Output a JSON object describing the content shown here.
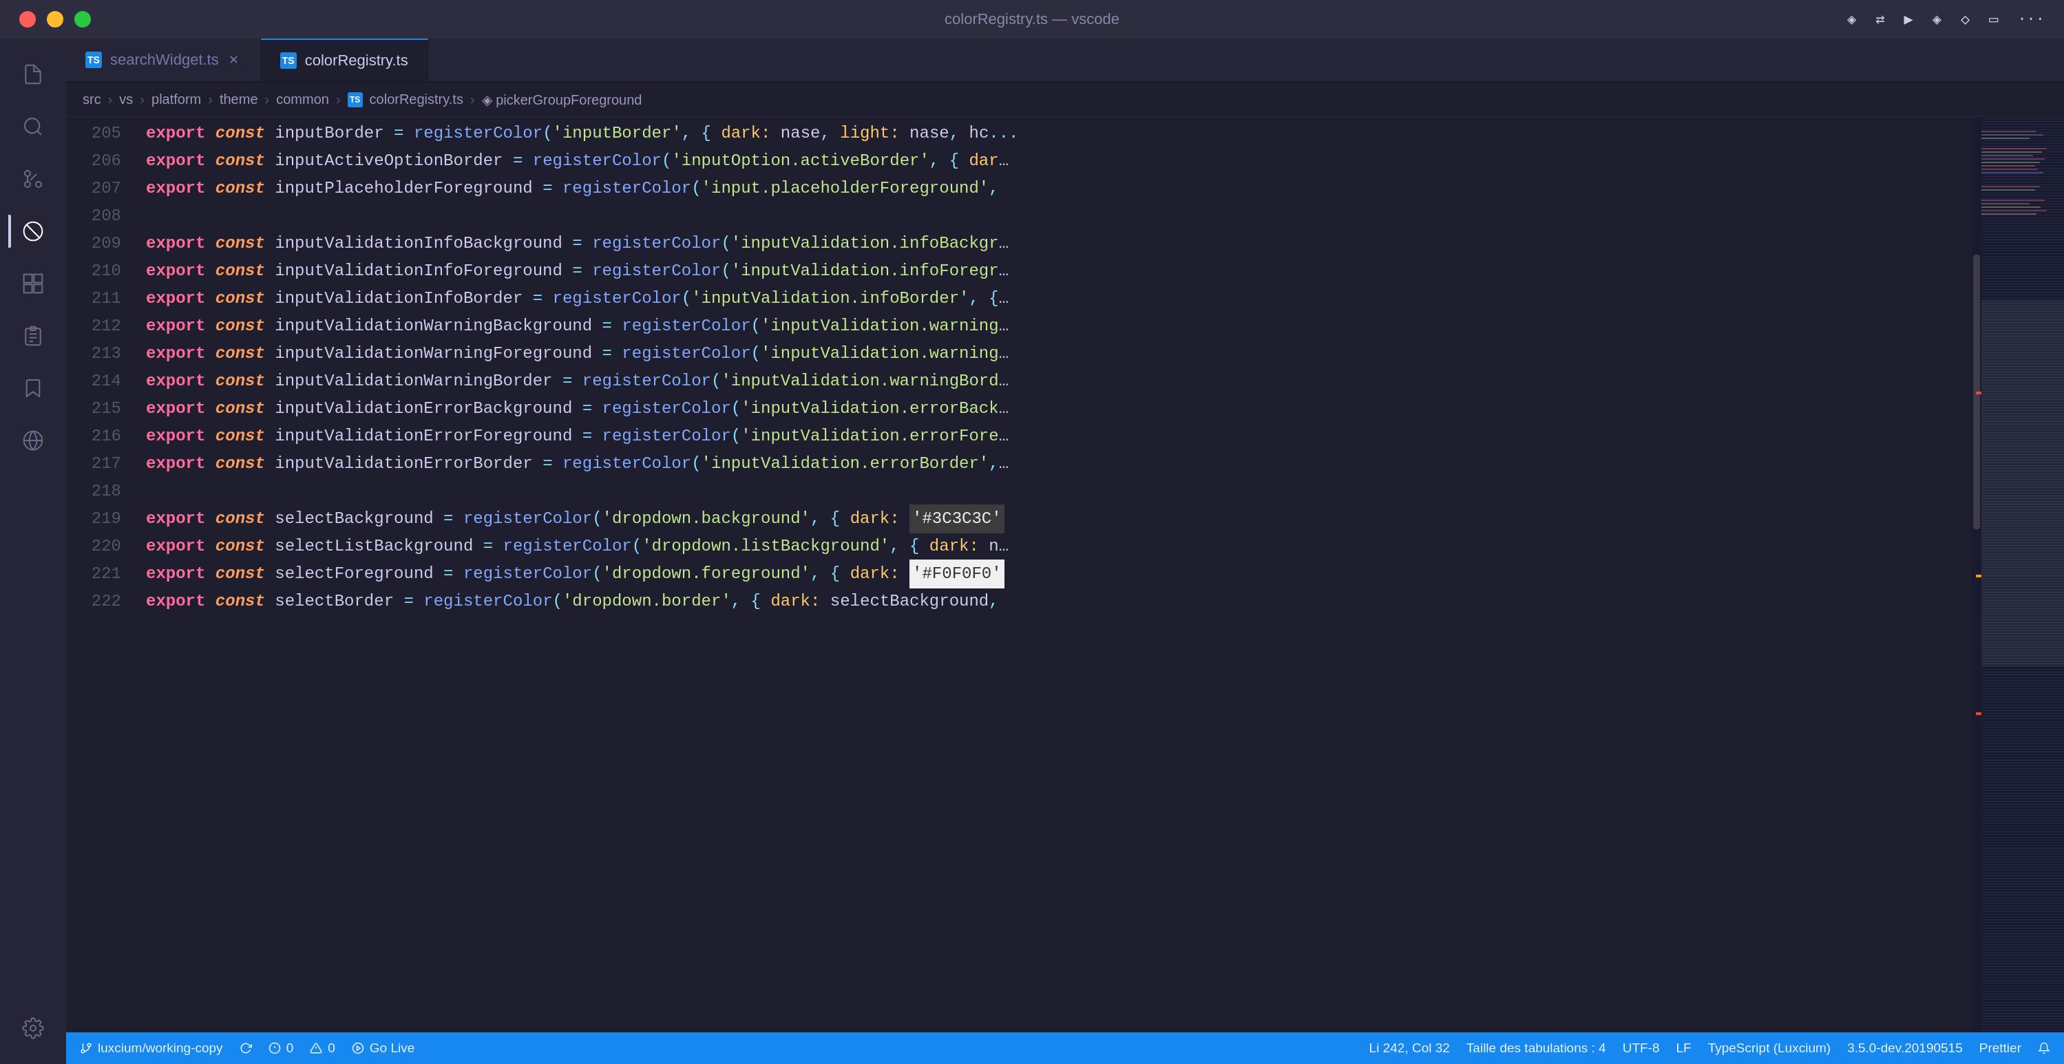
{
  "titleBar": {
    "title": "colorRegistry.ts — vscode",
    "trafficLabels": [
      "close",
      "minimize",
      "maximize"
    ]
  },
  "tabs": [
    {
      "id": "searchWidget",
      "icon": "TS",
      "label": "searchWidget.ts",
      "active": false,
      "closable": true
    },
    {
      "id": "colorRegistry",
      "icon": "TS",
      "label": "colorRegistry.ts",
      "active": true,
      "closable": false
    }
  ],
  "breadcrumb": {
    "parts": [
      "src",
      "vs",
      "platform",
      "theme",
      "common",
      "colorRegistry.ts",
      "pickerGroupForeground"
    ]
  },
  "codeLines": [
    {
      "num": "205",
      "content": "export const inputBorder = registerColor( 'inputBorder', { dark: nase, light: nase, he..."
    },
    {
      "num": "206",
      "content": "export const inputActiveOptionBorder = registerColor('inputOption.activeBorder', { dar..."
    },
    {
      "num": "207",
      "content": "export const inputPlaceholderForeground = registerColor('input.placeholderForeground',"
    },
    {
      "num": "208",
      "content": ""
    },
    {
      "num": "209",
      "content": "export const inputValidationInfoBackground = registerColor('inputValidation.infoBackgr..."
    },
    {
      "num": "210",
      "content": "export const inputValidationInfoForeground = registerColor('inputValidation.infoForegr..."
    },
    {
      "num": "211",
      "content": "export const inputValidationInfoBorder = registerColor('inputValidation.infoBorder', {..."
    },
    {
      "num": "212",
      "content": "export const inputValidationWarningBackground = registerColor('inputValidation.warning..."
    },
    {
      "num": "213",
      "content": "export const inputValidationWarningForeground = registerColor('inputValidation.warning..."
    },
    {
      "num": "214",
      "content": "export const inputValidationWarningBorder = registerColor('inputValidation.warningBord..."
    },
    {
      "num": "215",
      "content": "export const inputValidationErrorBackground = registerColor('inputValidation.errorBack..."
    },
    {
      "num": "216",
      "content": "export const inputValidationErrorForeground = registerColor('inputValidation.errorFore..."
    },
    {
      "num": "217",
      "content": "export const inputValidationErrorBorder = registerColor('inputValidation.errorBorder'..."
    },
    {
      "num": "218",
      "content": ""
    },
    {
      "num": "219",
      "content": "export const selectBackground = registerColor('dropdown.background', { dark: '#3C3C3C'"
    },
    {
      "num": "220",
      "content": "export const selectListBackground = registerColor('dropdown.listBackground', { dark: n..."
    },
    {
      "num": "221",
      "content": "export const selectForeground = registerColor('dropdown.foreground', { dark: '#F0F0F0'"
    },
    {
      "num": "222",
      "content": "export const selectBorder = registerColor('dropdown.border', { dark: selectBackground,"
    }
  ],
  "statusBar": {
    "branch": "luxcium/working-copy",
    "errors": "0",
    "warnings": "0",
    "goLive": "Go Live",
    "cursor": "Li 242, Col 32",
    "tabSize": "Taille des tabulations : 4",
    "encoding": "UTF-8",
    "lineEnding": "LF",
    "language": "TypeScript (Luxcium)",
    "version": "3.5.0-dev.20190515",
    "formatter": "Prettier",
    "bell": "🔔"
  },
  "activityBar": {
    "icons": [
      {
        "name": "files-icon",
        "symbol": "⎘",
        "active": false
      },
      {
        "name": "search-icon",
        "symbol": "🔍",
        "active": false
      },
      {
        "name": "source-control-icon",
        "symbol": "⑂",
        "active": false
      },
      {
        "name": "no-entry-icon",
        "symbol": "🚫",
        "active": true
      },
      {
        "name": "extensions-icon",
        "symbol": "⊞",
        "active": false
      },
      {
        "name": "clipboard-icon",
        "symbol": "📋",
        "active": false
      },
      {
        "name": "bookmark-icon",
        "symbol": "🔖",
        "active": false
      },
      {
        "name": "remote-icon",
        "symbol": "⊙",
        "active": false
      }
    ],
    "bottomIcons": [
      {
        "name": "settings-icon",
        "symbol": "⚙"
      }
    ]
  }
}
